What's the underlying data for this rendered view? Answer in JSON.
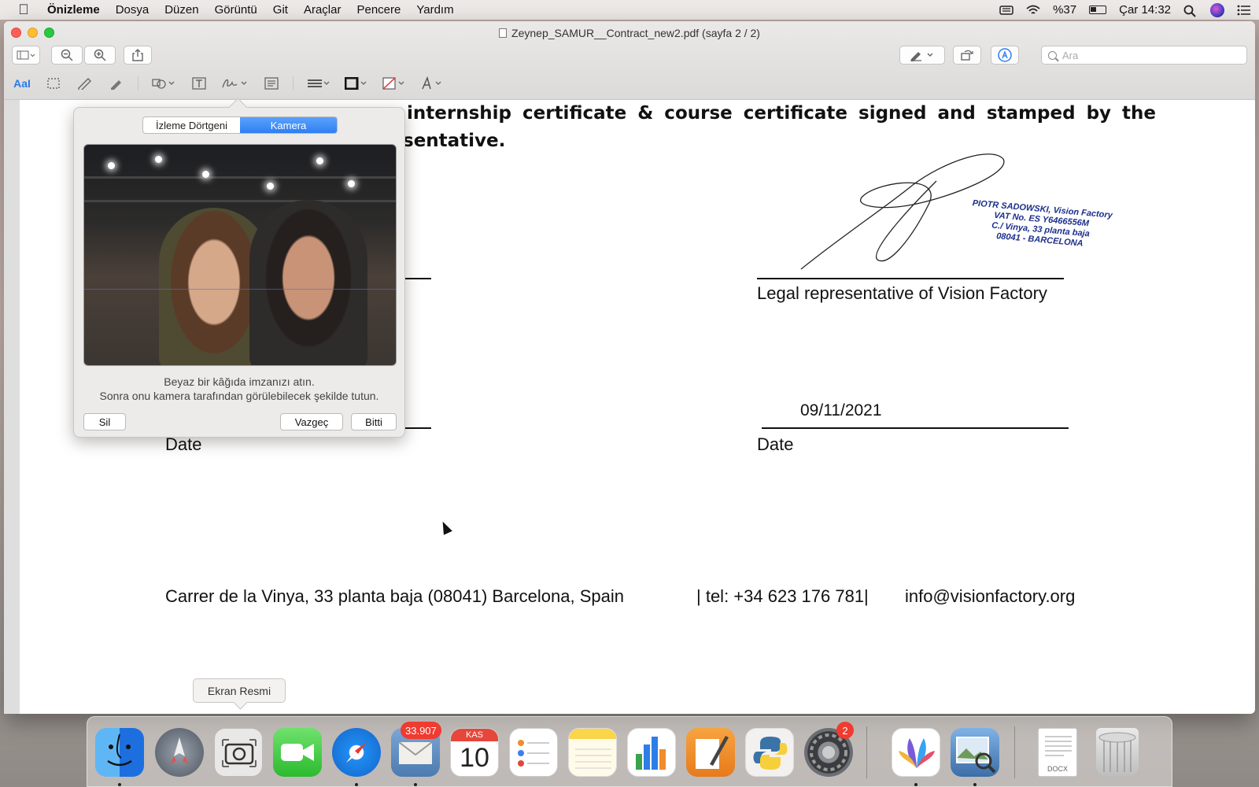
{
  "menubar": {
    "app": "Önizleme",
    "items": [
      "Dosya",
      "Düzen",
      "Görüntü",
      "Git",
      "Araçlar",
      "Pencere",
      "Yardım"
    ],
    "battery": "%37",
    "clock": "Çar 14:32"
  },
  "window": {
    "title": "Zeynep_SAMUR__Contract_new2.pdf (sayfa 2 / 2)",
    "search_placeholder": "Ara",
    "markup_text_tool": "AaI"
  },
  "document": {
    "line1": "internship certificate & course certificate signed and stamped by the",
    "line2": "sentative.",
    "legal_rep": "Legal representative of Vision Factory",
    "date_value": "09/11/2021",
    "date_left": "Date",
    "date_right": "Date",
    "footer_address": "Carrer de la Vinya, 33 planta baja (08041) Barcelona, Spain",
    "footer_tel": "| tel: +34 623 176 781|",
    "footer_email": "info@visionfactory.org",
    "stamp": {
      "line1": "PIOTR SADOWSKI, Vision Factory",
      "line2": "VAT No. ES Y6466556M",
      "line3": "C./ Vinya, 33 planta baja",
      "line4": "08041 - BARCELONA"
    }
  },
  "signature_popover": {
    "tab_trackpad": "İzleme Dörtgeni",
    "tab_camera": "Kamera",
    "instruction1": "Beyaz bir kâğıda imzanızı atın.",
    "instruction2": "Sonra onu kamera tarafından görülebilecek şekilde tutun.",
    "clear_button": "Sil",
    "cancel_button": "Vazgeç",
    "done_button": "Bitti"
  },
  "tooltip": "Ekran Resmi",
  "dock": {
    "mail_badge": "33.907",
    "calendar_month": "KAS",
    "calendar_day": "10",
    "prefs_badge": "2",
    "docx_label": "DOCX"
  },
  "colors": {
    "accent": "#2f7ff4",
    "badge": "#ef3b30",
    "stamp": "#1b2f8a"
  }
}
